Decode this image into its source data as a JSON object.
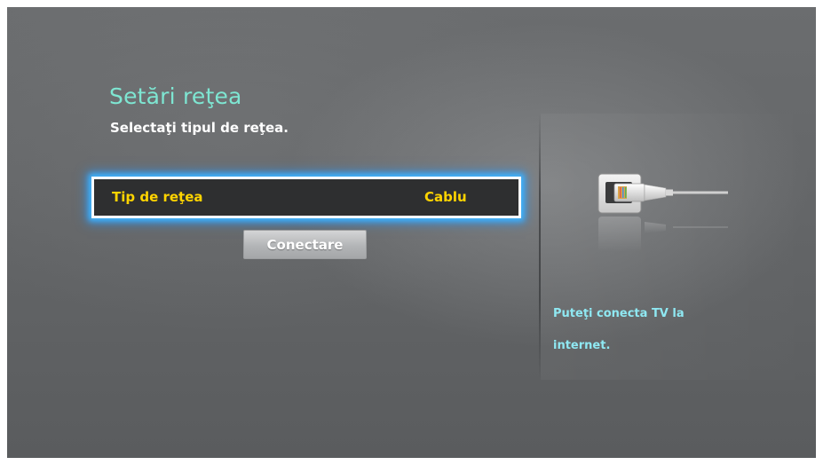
{
  "screen": {
    "title": "Setări reţea",
    "subtitle": "Selectaţi tipul de reţea."
  },
  "network_type": {
    "label": "Tip de reţea",
    "value": "Cablu"
  },
  "buttons": {
    "connect_label": "Conectare"
  },
  "side_panel": {
    "icon": "ethernet-cable-icon",
    "hint": "Puteţi conecta TV la internet."
  },
  "colors": {
    "title": "#7ee6d2",
    "highlight_text": "#ffd400",
    "focus_glow": "#3fb6ff",
    "hint_text": "#8fe8f2"
  }
}
